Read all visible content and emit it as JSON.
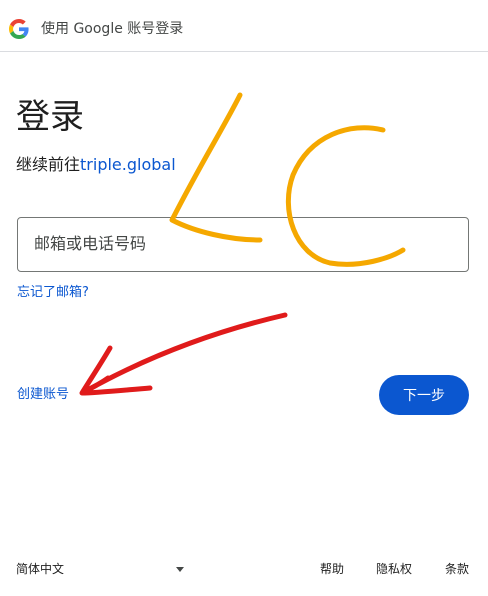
{
  "header": {
    "title": "使用 Google 账号登录",
    "logo_icon": "google-g-icon"
  },
  "main": {
    "title": "登录",
    "subtitle_prefix": "继续前往",
    "subtitle_link": "triple.global",
    "email_placeholder": "邮箱或电话号码",
    "forgot_email": "忘记了邮箱?",
    "create_account": "创建账号",
    "next_button": "下一步"
  },
  "footer": {
    "language": "简体中文",
    "help": "帮助",
    "privacy": "隐私权",
    "terms": "条款"
  },
  "colors": {
    "primary": "#0b57d0",
    "annotation_orange": "#f5a800",
    "annotation_red": "#e01b1b"
  }
}
